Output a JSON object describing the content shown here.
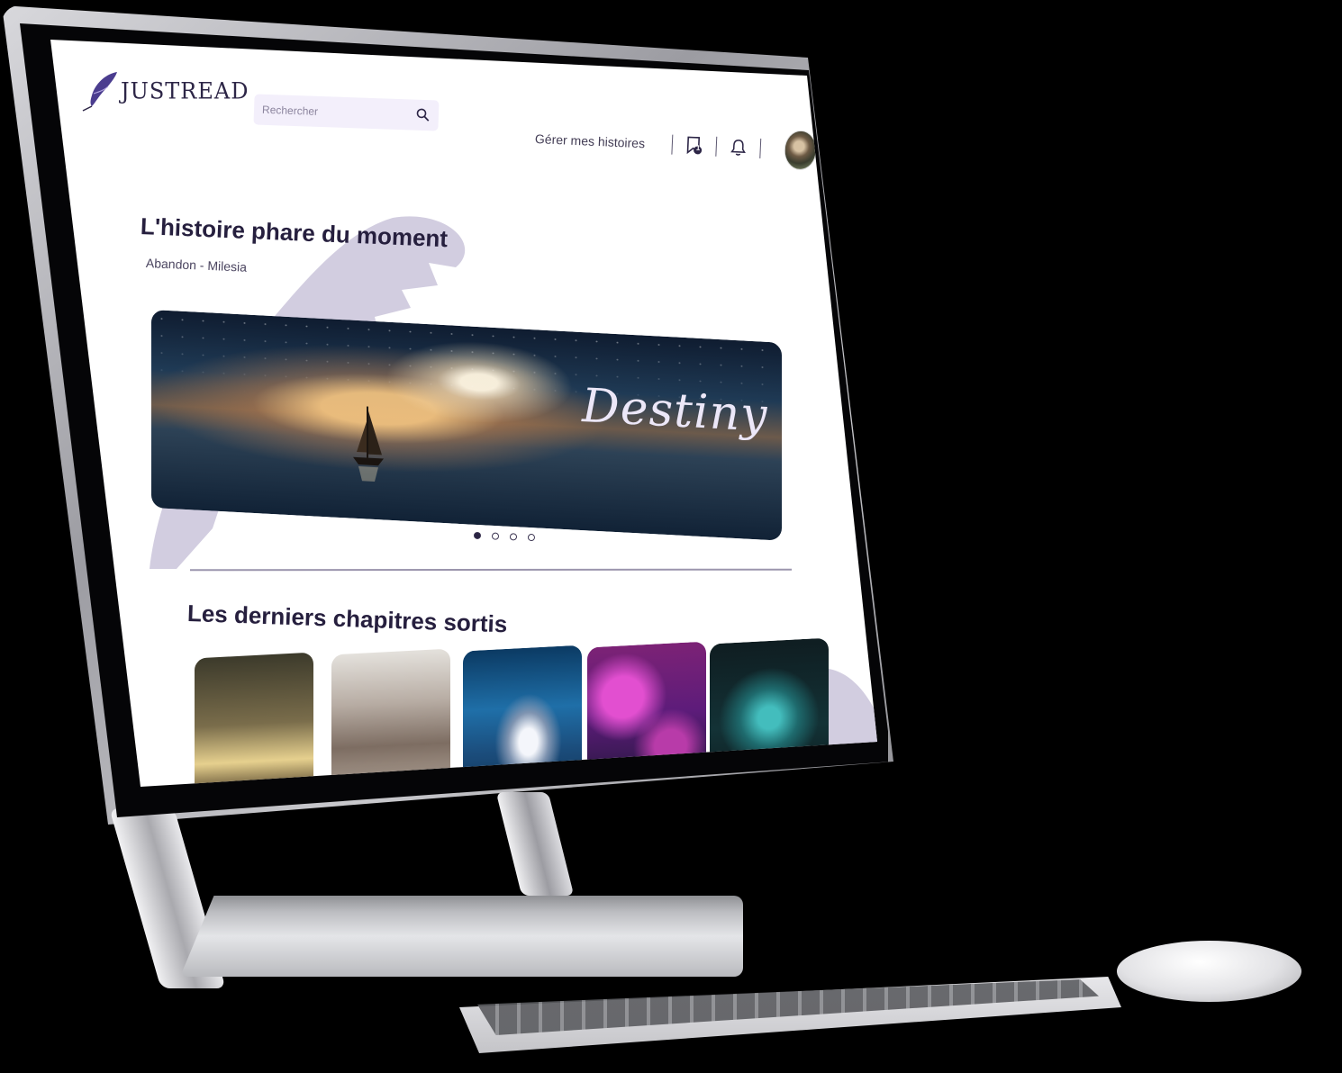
{
  "app": {
    "logo_text": "JUSTREAD"
  },
  "header": {
    "search": {
      "placeholder": "Rechercher",
      "value": ""
    },
    "manage_stories_label": "Gérer mes histoires",
    "bookmark_badge_count": "1"
  },
  "featured": {
    "title": "L'histoire phare du moment",
    "subtitle": "Abandon - Milesia",
    "banner_title": "Destiny",
    "carousel": {
      "total": 4,
      "active_index": 0
    }
  },
  "latest": {
    "title": "Les derniers chapitres sortis",
    "cards": [
      {
        "theme": "forest-light-path"
      },
      {
        "theme": "misty-castle"
      },
      {
        "theme": "underwater-girl"
      },
      {
        "theme": "pink-blossom-forest"
      },
      {
        "theme": "teal-nebula"
      }
    ]
  },
  "colors": {
    "brand": "#2d2647",
    "accent_lavender": "#d2cde0",
    "search_bg": "#f3effb",
    "text_dark": "#261f3e"
  },
  "icons": [
    "feather-logo-icon",
    "search-icon",
    "bookmark-icon",
    "bell-icon"
  ]
}
